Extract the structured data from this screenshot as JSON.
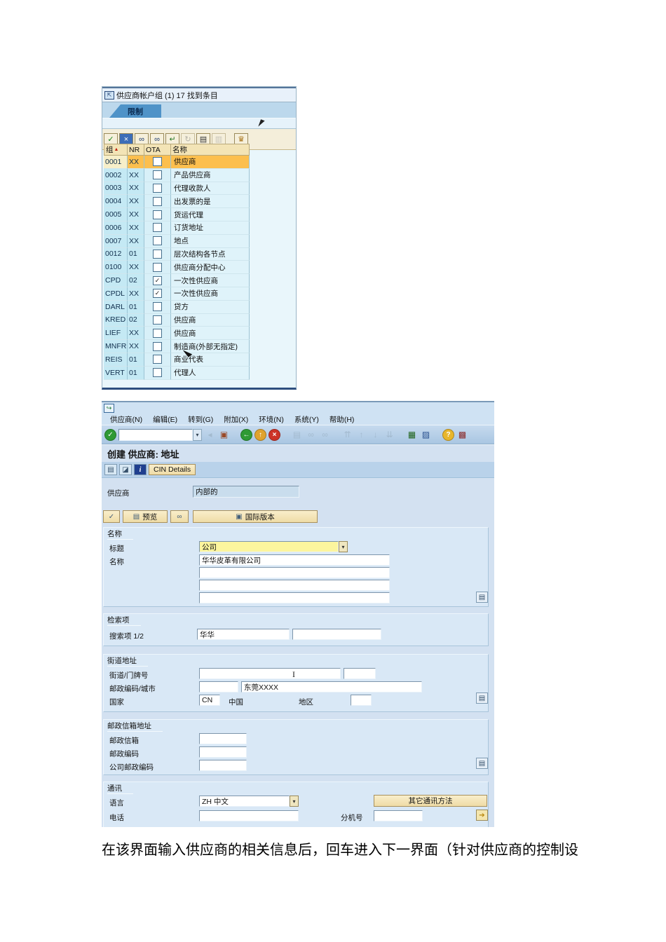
{
  "caption": "在该界面输入供应商的相关信息后，回车进入下一界面（针对供应商的控制设",
  "dialog": {
    "title": "供应商帐户组 (1)   17 找到条目",
    "tab_label": "限制",
    "toolbar": [
      {
        "name": "continue-icon",
        "glyph": "✓",
        "color": "#17861a"
      },
      {
        "name": "cancel-icon",
        "glyph": "×",
        "color": "#ffffff",
        "bg": "#3d6db8"
      },
      {
        "name": "find-icon",
        "glyph": "∞",
        "color": "#1c3a6e"
      },
      {
        "name": "find-next-icon",
        "glyph": "∞",
        "color": "#1c3a6e"
      },
      {
        "name": "copy-entries-icon",
        "glyph": "↵",
        "color": "#2a7a2a"
      },
      {
        "name": "refresh-icon",
        "glyph": "↻",
        "color": "#777777",
        "disabled": true
      },
      {
        "name": "print-icon",
        "glyph": "▤",
        "color": "#333333"
      },
      {
        "name": "copy-icon",
        "glyph": "▥",
        "color": "#999999",
        "disabled": true
      },
      {
        "name": "personal-value-list-icon",
        "glyph": "♛",
        "color": "#a8741a",
        "gap": true
      }
    ],
    "table": {
      "headers": [
        "组",
        "NR",
        "OTA",
        "名称"
      ],
      "rows": [
        {
          "group": "0001",
          "nr": "XX",
          "ota": false,
          "name": "供应商",
          "selected": true
        },
        {
          "group": "0002",
          "nr": "XX",
          "ota": false,
          "name": "产品供应商"
        },
        {
          "group": "0003",
          "nr": "XX",
          "ota": false,
          "name": "代理收款人"
        },
        {
          "group": "0004",
          "nr": "XX",
          "ota": false,
          "name": "出发票的是"
        },
        {
          "group": "0005",
          "nr": "XX",
          "ota": false,
          "name": "货运代理"
        },
        {
          "group": "0006",
          "nr": "XX",
          "ota": false,
          "name": "订货地址"
        },
        {
          "group": "0007",
          "nr": "XX",
          "ota": false,
          "name": "地点"
        },
        {
          "group": "0012",
          "nr": "01",
          "ota": false,
          "name": "层次结构各节点"
        },
        {
          "group": "0100",
          "nr": "XX",
          "ota": false,
          "name": "供应商分配中心"
        },
        {
          "group": "CPD",
          "nr": "02",
          "ota": true,
          "name": "一次性供应商"
        },
        {
          "group": "CPDL",
          "nr": "XX",
          "ota": true,
          "name": "一次性供应商"
        },
        {
          "group": "DARL",
          "nr": "01",
          "ota": false,
          "name": "贷方"
        },
        {
          "group": "KRED",
          "nr": "02",
          "ota": false,
          "name": "供应商"
        },
        {
          "group": "LIEF",
          "nr": "XX",
          "ota": false,
          "name": "供应商"
        },
        {
          "group": "MNFR",
          "nr": "XX",
          "ota": false,
          "name": "制造商(外部无指定)"
        },
        {
          "group": "REIS",
          "nr": "01",
          "ota": false,
          "name": "商业代表"
        },
        {
          "group": "VERT",
          "nr": "01",
          "ota": false,
          "name": "代理人"
        }
      ]
    }
  },
  "sap": {
    "menu": [
      "供应商(N)",
      "编辑(E)",
      "转到(G)",
      "附加(X)",
      "环境(N)",
      "系统(Y)",
      "帮助(H)"
    ],
    "toolbar": [
      {
        "kind": "circle",
        "name": "enter-icon",
        "glyph": "✓",
        "bg": "#2f9a35"
      },
      {
        "kind": "input",
        "name": "command-field",
        "value": ""
      },
      {
        "kind": "flat",
        "name": "menu-collapse-icon",
        "glyph": "◂",
        "disabled": true
      },
      {
        "kind": "flat",
        "name": "save-icon",
        "glyph": "▣",
        "color": "#9a4a28"
      },
      {
        "kind": "gap"
      },
      {
        "kind": "circle",
        "name": "back-icon",
        "glyph": "←",
        "bg": "#2f9a35"
      },
      {
        "kind": "circle",
        "name": "exit-icon",
        "glyph": "↑",
        "bg": "#e0a32e"
      },
      {
        "kind": "circle",
        "name": "cancel-icon",
        "glyph": "×",
        "bg": "#cc3327"
      },
      {
        "kind": "gap"
      },
      {
        "kind": "flat",
        "name": "print-icon",
        "glyph": "▤",
        "disabled": true
      },
      {
        "kind": "flat",
        "name": "find-icon",
        "glyph": "∞",
        "disabled": true
      },
      {
        "kind": "flat",
        "name": "find-next-icon",
        "glyph": "∞",
        "disabled": true
      },
      {
        "kind": "gap"
      },
      {
        "kind": "flat",
        "name": "first-page-icon",
        "glyph": "⇈",
        "disabled": true
      },
      {
        "kind": "flat",
        "name": "previous-page-icon",
        "glyph": "↑",
        "disabled": true
      },
      {
        "kind": "flat",
        "name": "next-page-icon",
        "glyph": "↓",
        "disabled": true
      },
      {
        "kind": "flat",
        "name": "last-page-icon",
        "glyph": "⇊",
        "disabled": true
      },
      {
        "kind": "gap"
      },
      {
        "kind": "flat",
        "name": "new-session-icon",
        "glyph": "▦",
        "color": "#22651f"
      },
      {
        "kind": "flat",
        "name": "create-shortcut-icon",
        "glyph": "▨",
        "color": "#274f8e"
      },
      {
        "kind": "gap"
      },
      {
        "kind": "circle",
        "name": "help-icon",
        "glyph": "?",
        "bg": "#e8b62c"
      },
      {
        "kind": "flat",
        "name": "customize-layout-icon",
        "glyph": "▩",
        "color": "#8a2a2a"
      }
    ],
    "screen_title": "创建 供应商: 地址",
    "app_toolbar": {
      "icons": [
        {
          "name": "display-icon",
          "glyph": "▤"
        },
        {
          "name": "change-icon",
          "glyph": "◪"
        },
        {
          "name": "info-icon",
          "glyph": "i",
          "info": true
        }
      ],
      "cin_details": "CIN Details"
    },
    "vendor_label": "供应商",
    "vendor_value": "内部的",
    "buttons": {
      "preview": "预览",
      "international": "国际版本"
    },
    "sections": {
      "name": {
        "label": "名称",
        "title_label": "标题",
        "title_value": "公司",
        "name_label": "名称",
        "name_value": "华华皮革有限公司"
      },
      "search": {
        "label": "检索项",
        "term_label": "搜索项 1/2",
        "term1": "华华",
        "term2": ""
      },
      "street": {
        "label": "街道地址",
        "street_label": "街道/门牌号",
        "postal_city_label": "邮政编码/城市",
        "city_value": "东莞XXXX",
        "country_label": "国家",
        "country_code": "CN",
        "country_name": "中国",
        "region_label": "地区"
      },
      "pobox": {
        "label": "邮政信箱地址",
        "rows": [
          "邮政信箱",
          "邮政编码",
          "公司邮政编码"
        ]
      },
      "comm": {
        "label": "通讯",
        "language_label": "语言",
        "language_value": "ZH 中文",
        "other_methods": "其它通讯方法",
        "phone_label": "电话",
        "extension_label": "分机号"
      }
    },
    "colors": {
      "selected_row": "#fcbf4e",
      "combo_yellow": "#fcf59e",
      "button_tan": "#f3e2ae",
      "window_bg": "#d3e1f1"
    }
  }
}
